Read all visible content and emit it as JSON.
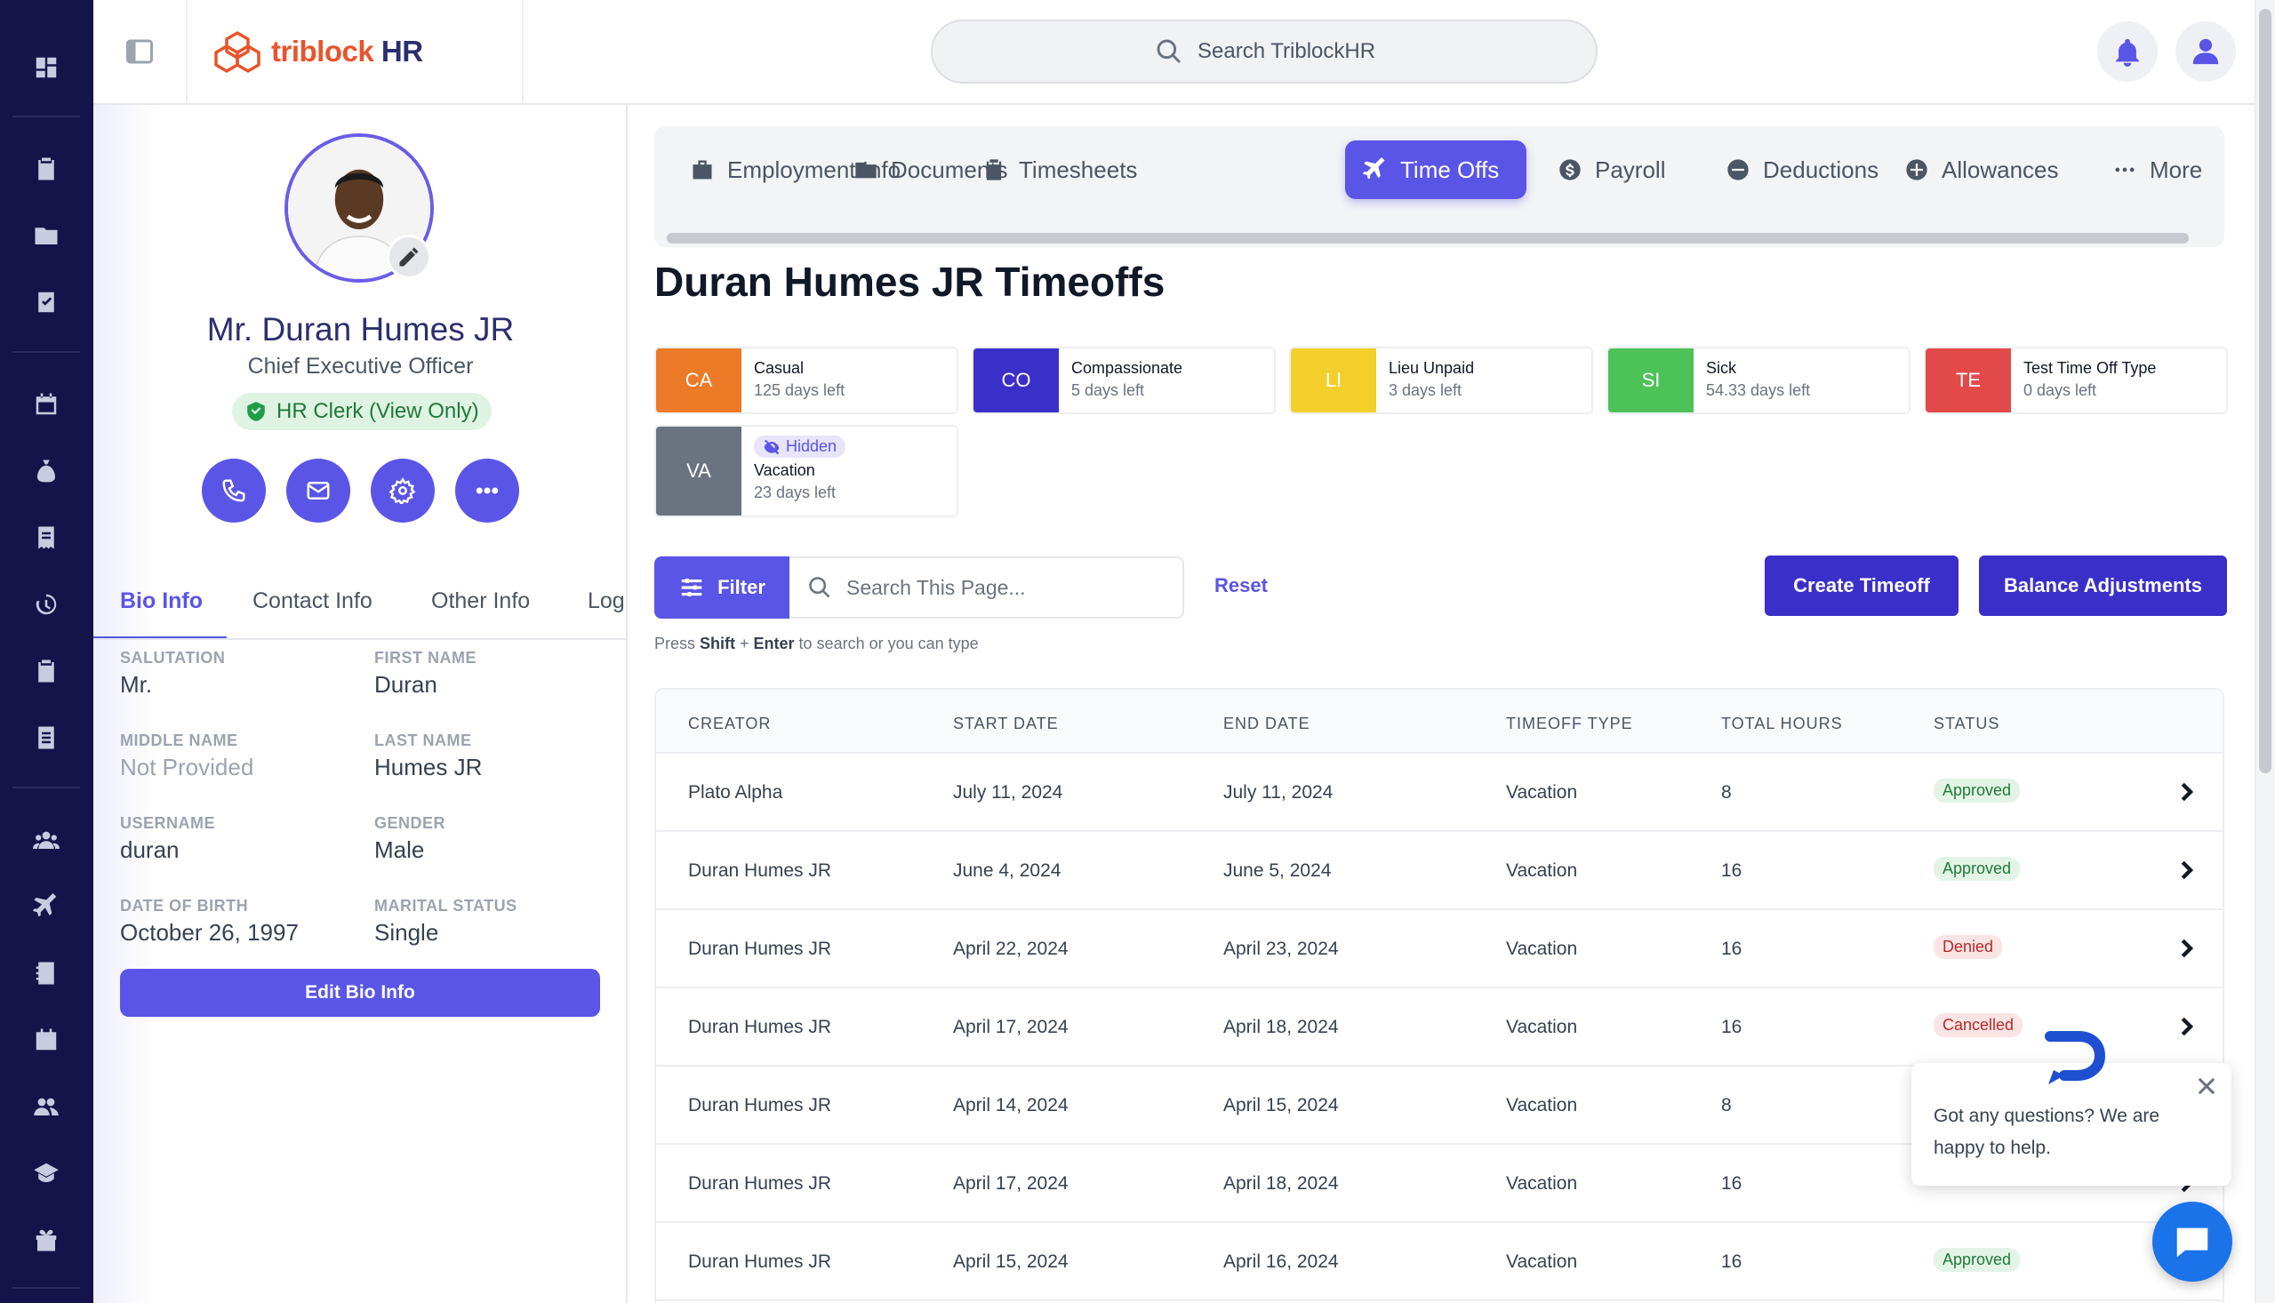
{
  "brand": {
    "name_main": "triblock",
    "name_suffix": " HR"
  },
  "search": {
    "placeholder": "Search TriblockHR"
  },
  "rail_icons": [
    "dashboard-icon",
    "clipboard-icon",
    "folder-icon",
    "task-check-icon",
    "calendar-icon",
    "money-bag-icon",
    "receipt-icon",
    "history-icon",
    "clipboard-list-icon",
    "document-icon",
    "users-icon",
    "plane-icon",
    "contact-book-icon",
    "calendar-grid-icon",
    "team-icon",
    "graduation-cap-icon",
    "gift-icon"
  ],
  "profile": {
    "name": "Mr. Duran Humes JR",
    "title": "Chief Executive Officer",
    "role": "HR Clerk (View Only)",
    "tabs": [
      "Bio Info",
      "Contact Info",
      "Other Info",
      "Log"
    ],
    "fields": [
      {
        "label": "SALUTATION",
        "value": "Mr."
      },
      {
        "label": "FIRST NAME",
        "value": "Duran"
      },
      {
        "label": "MIDDLE NAME",
        "value": "Not Provided"
      },
      {
        "label": "LAST NAME",
        "value": "Humes JR"
      },
      {
        "label": "USERNAME",
        "value": "duran"
      },
      {
        "label": "GENDER",
        "value": "Male"
      },
      {
        "label": "DATE OF BIRTH",
        "value": "October 26, 1997"
      },
      {
        "label": "MARITAL STATUS",
        "value": "Single"
      }
    ],
    "edit_label": "Edit Bio Info"
  },
  "tabs": [
    {
      "label": "Employment Info",
      "icon": "briefcase-icon"
    },
    {
      "label": "Documents",
      "icon": "folder-icon"
    },
    {
      "label": "Timesheets",
      "icon": "clipboard-icon"
    },
    {
      "label": "Time Offs",
      "icon": "plane-icon",
      "active": true
    },
    {
      "label": "Payroll",
      "icon": "dollar-icon"
    },
    {
      "label": "Deductions",
      "icon": "minus-circle-icon"
    },
    {
      "label": "Allowances",
      "icon": "plus-circle-icon"
    },
    {
      "label": "More",
      "icon": "more-dots-icon"
    }
  ],
  "page_title": "Duran Humes JR Timeoffs",
  "timeoff_types": [
    {
      "abbr": "CA",
      "name": "Casual",
      "left": "125 days left",
      "color": "#ec7a27"
    },
    {
      "abbr": "CO",
      "name": "Compassionate",
      "left": "5 days left",
      "color": "#3b2fc9"
    },
    {
      "abbr": "LI",
      "name": "Lieu Unpaid",
      "left": "3 days left",
      "color": "#f2cf2a"
    },
    {
      "abbr": "SI",
      "name": "Sick",
      "left": "54.33 days left",
      "color": "#4cc257"
    },
    {
      "abbr": "TE",
      "name": "Test Time Off Type",
      "left": "0 days left",
      "color": "#e24a4a"
    },
    {
      "abbr": "VA",
      "name": "Vacation",
      "left": "23 days left",
      "color": "#6b7280",
      "hidden_label": "Hidden"
    }
  ],
  "toolbar": {
    "filter_label": "Filter",
    "search_placeholder": "Search This Page...",
    "reset_label": "Reset",
    "hint_prefix": "Press ",
    "hint_key1": "Shift",
    "hint_plus": " + ",
    "hint_key2": "Enter",
    "hint_suffix": " to search or you can type",
    "create_label": "Create Timeoff",
    "balance_label": "Balance Adjustments"
  },
  "table": {
    "headers": [
      "CREATOR",
      "START DATE",
      "END DATE",
      "TIMEOFF TYPE",
      "TOTAL HOURS",
      "STATUS"
    ],
    "rows": [
      {
        "creator": "Plato Alpha",
        "start": "July 11, 2024",
        "end": "July 11, 2024",
        "type": "Vacation",
        "hours": "8",
        "status": "Approved",
        "kind": "approved"
      },
      {
        "creator": "Duran Humes JR",
        "start": "June 4, 2024",
        "end": "June 5, 2024",
        "type": "Vacation",
        "hours": "16",
        "status": "Approved",
        "kind": "approved"
      },
      {
        "creator": "Duran Humes JR",
        "start": "April 22, 2024",
        "end": "April 23, 2024",
        "type": "Vacation",
        "hours": "16",
        "status": "Denied",
        "kind": "denied"
      },
      {
        "creator": "Duran Humes JR",
        "start": "April 17, 2024",
        "end": "April 18, 2024",
        "type": "Vacation",
        "hours": "16",
        "status": "Cancelled",
        "kind": "cancelled"
      },
      {
        "creator": "Duran Humes JR",
        "start": "April 14, 2024",
        "end": "April 15, 2024",
        "type": "Vacation",
        "hours": "8",
        "status": "",
        "kind": ""
      },
      {
        "creator": "Duran Humes JR",
        "start": "April 17, 2024",
        "end": "April 18, 2024",
        "type": "Vacation",
        "hours": "16",
        "status": "",
        "kind": ""
      },
      {
        "creator": "Duran Humes JR",
        "start": "April 15, 2024",
        "end": "April 16, 2024",
        "type": "Vacation",
        "hours": "16",
        "status": "Approved",
        "kind": "approved"
      }
    ]
  },
  "chat": {
    "message": "Got any questions? We are happy to help."
  }
}
